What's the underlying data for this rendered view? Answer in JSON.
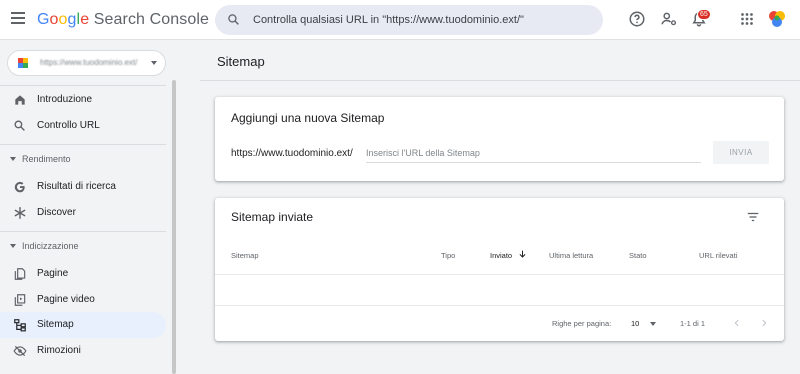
{
  "app": {
    "logo": {
      "g1": "G",
      "g2": "o",
      "g3": "o",
      "g4": "g",
      "g5": "l",
      "g6": "e",
      "product": "Search Console"
    }
  },
  "search": {
    "placeholder": "Controlla qualsiasi URL in \"https://www.tuodominio.ext/\""
  },
  "header": {
    "notification_count": "65",
    "icons": [
      "help-icon",
      "manage-users-icon",
      "notifications-icon",
      "apps-grid-icon",
      "account-avatar-icon"
    ]
  },
  "sidebar": {
    "property_selector": {
      "value": "https://www.tuodominio.ext/"
    },
    "items_top": [
      {
        "label": "Introduzione",
        "icon": "home-icon"
      },
      {
        "label": "Controllo URL",
        "icon": "search-icon"
      }
    ],
    "sections": [
      {
        "title": "Rendimento",
        "items": [
          {
            "label": "Risultati di ricerca",
            "icon": "google-g-icon"
          },
          {
            "label": "Discover",
            "icon": "discover-asterisk-icon"
          }
        ]
      },
      {
        "title": "Indicizzazione",
        "items": [
          {
            "label": "Pagine",
            "icon": "pages-icon"
          },
          {
            "label": "Pagine video",
            "icon": "video-pages-icon"
          },
          {
            "label": "Sitemap",
            "icon": "sitemap-icon",
            "active": true
          },
          {
            "label": "Rimozioni",
            "icon": "removals-icon"
          }
        ]
      }
    ]
  },
  "main": {
    "page_title": "Sitemap",
    "add_card": {
      "title": "Aggiungi una nuova Sitemap",
      "prefix": "https://www.tuodominio.ext/",
      "input_placeholder": "Inserisci l'URL della Sitemap",
      "input_value": "",
      "submit_label": "INVIA"
    },
    "submitted_card": {
      "title": "Sitemap inviate",
      "columns": [
        "Sitemap",
        "Tipo",
        "Inviato",
        "Ultima lettura",
        "Stato",
        "URL rilevati"
      ],
      "sorted_column": "Inviato",
      "sort_direction": "descending",
      "rows": [],
      "pagination": {
        "rows_per_page_label": "Righe per pagina:",
        "rows_per_page_value": "10",
        "range": "1-1 di 1"
      }
    }
  },
  "colors": {
    "active_nav_bg": "#e8f0fe",
    "page_bg": "#f1f3f4",
    "badge": "#d93025",
    "google_blue": "#4285f4",
    "google_red": "#ea4335",
    "google_yellow": "#fbbc05",
    "google_green": "#34a853"
  }
}
